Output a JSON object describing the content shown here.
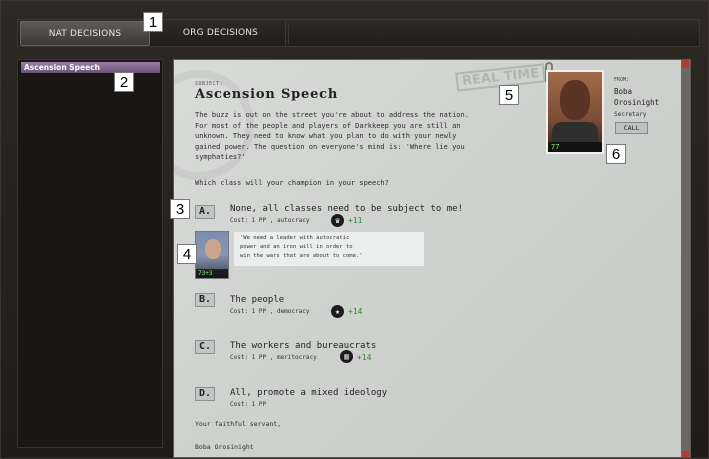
{
  "tabs": [
    {
      "label": "NAT DECISIONS",
      "active": true
    },
    {
      "label": "ORG DECISIONS",
      "active": false
    }
  ],
  "badges": [
    "1",
    "2",
    "3",
    "4",
    "5",
    "6"
  ],
  "sidebar": {
    "items": [
      {
        "label": "Ascension Speech",
        "selected": true
      }
    ]
  },
  "letter": {
    "subject_label": "SUBJECT:",
    "subject": "Ascension Speech",
    "stamp": "REAL TIME",
    "body_lines": [
      "The buzz is out on the street you're about to address the nation.",
      "For most of the people and players of Darkkeep you are still an",
      "unknown. They need to know what you plan to do with your newly",
      "gained power. The question on everyone's mind is: 'Where lie you",
      "symphaties?'"
    ],
    "question": "Which class will your champion in your speech?",
    "options": [
      {
        "letter": "A.",
        "title": "None, all classes need to be subject to me!",
        "cost": "Cost: 1 PP , autocracy",
        "icon": "crown-icon",
        "glyph": "♛",
        "gain": "+11"
      },
      {
        "letter": "B.",
        "title": "The people",
        "cost": "Cost: 1 PP , democracy",
        "icon": "star-icon",
        "glyph": "★",
        "gain": "+14"
      },
      {
        "letter": "C.",
        "title": "The workers and bureaucrats",
        "cost": "Cost: 1 PP , meritocracy",
        "icon": "building-icon",
        "glyph": "▥",
        "gain": "+14"
      },
      {
        "letter": "D.",
        "title": "All, promote a mixed ideology",
        "cost": "Cost: 1 PP",
        "icon": "",
        "glyph": "",
        "gain": ""
      }
    ],
    "advisor": {
      "stat": "73+3",
      "quote": [
        "'We need a leader with autocratic",
        "power and an iron will in order to",
        "win the wars that are about to come.'"
      ]
    },
    "closing": "Your faithful servant,",
    "signature": "Boba Orosinight"
  },
  "sender": {
    "from_label": "FROM:",
    "name_lines": [
      "Boba",
      "Orosinight"
    ],
    "role": "Secretary",
    "call_label": "CALL",
    "stat": "77"
  },
  "colors": {
    "accent_green": "#2e8b2e",
    "sidebar_selected": "#8a6f98"
  }
}
